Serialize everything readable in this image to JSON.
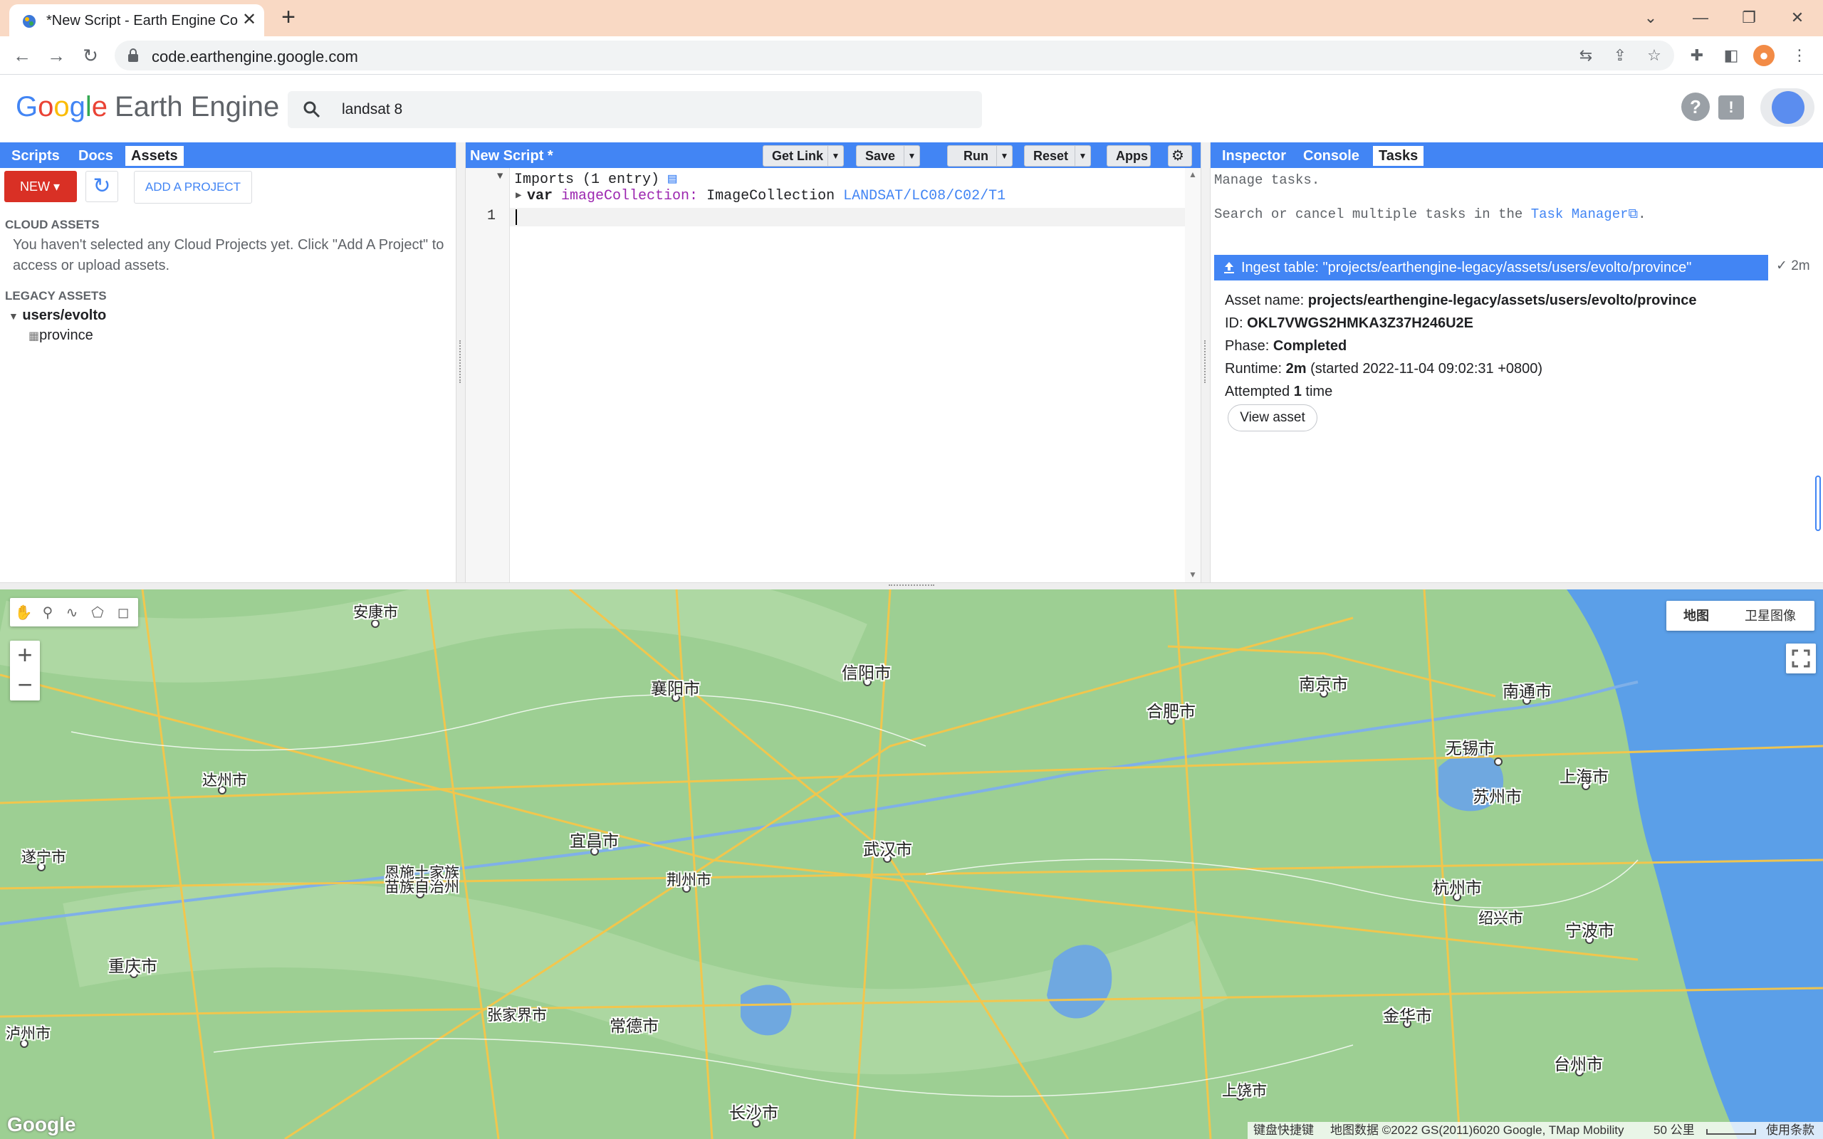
{
  "browser": {
    "tab_title": "*New Script - Earth Engine Co",
    "close_glyph": "✕",
    "new_tab_glyph": "+",
    "url": "code.earthengine.google.com"
  },
  "header": {
    "logo_google": [
      "G",
      "o",
      "o",
      "g",
      "l",
      "e"
    ],
    "logo_product": "Earth Engine",
    "search_value": "landsat 8"
  },
  "left_panel": {
    "tabs": [
      "Scripts",
      "Docs",
      "Assets"
    ],
    "active_tab": "Assets",
    "new_button": "NEW",
    "add_project_button": "ADD A PROJECT",
    "cloud_assets_title": "CLOUD ASSETS",
    "cloud_assets_message": "You haven't selected any Cloud Projects yet. Click \"Add A Project\" to access or upload assets.",
    "legacy_assets_title": "LEGACY ASSETS",
    "tree": {
      "folder": "users/evolto",
      "table": "province"
    }
  },
  "editor": {
    "title": "New Script *",
    "buttons": {
      "get_link": "Get Link",
      "save": "Save",
      "run": "Run",
      "reset": "Reset",
      "apps": "Apps"
    },
    "imports_line": "Imports (1 entry)",
    "import_keyword": "var",
    "import_name": "imageCollection:",
    "import_type": "ImageCollection",
    "import_id": "LANDSAT/LC08/C02/T1",
    "line_number": "1"
  },
  "right_panel": {
    "tabs": [
      "Inspector",
      "Console",
      "Tasks"
    ],
    "active_tab": "Tasks",
    "manage_text": "Manage tasks.",
    "search_text": "Search or cancel multiple tasks in the",
    "task_manager_link": "Task Manager",
    "task": {
      "title": "Ingest table: \"projects/earthengine-legacy/assets/users/evolto/province\"",
      "duration": "2m",
      "asset_name_label": "Asset name:",
      "asset_name": "projects/earthengine-legacy/assets/users/evolto/province",
      "id_label": "ID:",
      "id": "OKL7VWGS2HMKA3Z37H246U2E",
      "phase_label": "Phase:",
      "phase": "Completed",
      "runtime_label": "Runtime:",
      "runtime": "2m",
      "runtime_started": "(started 2022-11-04 09:02:31 +0800)",
      "attempted_prefix": "Attempted",
      "attempted_count": "1",
      "attempted_suffix": "time",
      "view_asset_button": "View asset"
    }
  },
  "map": {
    "map_type_map": "地图",
    "map_type_satellite": "卫星图像",
    "google_watermark": "Google",
    "attribution": {
      "shortcuts": "键盘快捷键",
      "data": "地图数据 ©2022 GS(2011)6020 Google, TMap Mobility",
      "scale": "50 公里",
      "terms": "使用条款"
    },
    "cities": [
      "安康市",
      "襄阳市",
      "信阳市",
      "合肥市",
      "南京市",
      "南通市",
      "无锡市",
      "上海市",
      "苏州市",
      "达州市",
      "宜昌市",
      "武汉市",
      "遂宁市",
      "恩施土家族",
      "苗族自治州",
      "荆州市",
      "杭州市",
      "绍兴市",
      "宁波市",
      "重庆市",
      "泸州市",
      "张家界市",
      "常德市",
      "金华市",
      "台州市",
      "上饶市",
      "长沙市"
    ]
  },
  "colors": {
    "accent": "#4285f4",
    "new_button": "#d93025",
    "map_land": "#9dcf93",
    "map_water": "#6fa8e0",
    "map_sea": "#5b9fe8",
    "map_roads": "#f6c64a",
    "tab_bar": "#f9d9c4"
  }
}
